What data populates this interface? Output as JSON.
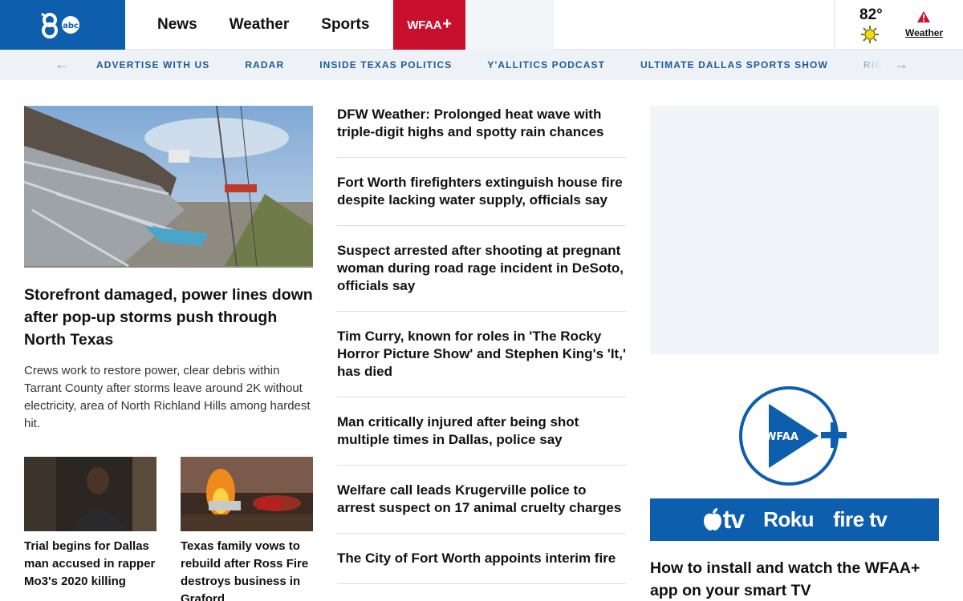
{
  "header": {
    "logo_text": "abc",
    "nav": [
      "News",
      "Weather",
      "Sports"
    ],
    "plus_tab": {
      "label": "WFAA",
      "plus": "+"
    },
    "weather": {
      "temp": "82°",
      "link": "Weather"
    }
  },
  "subnav": {
    "items": [
      "ADVERTISE WITH US",
      "RADAR",
      "INSIDE TEXAS POLITICS",
      "Y'ALLITICS PODCAST",
      "ULTIMATE DALLAS SPORTS SHOW",
      "RIGHT C"
    ]
  },
  "lead": {
    "title": "Storefront damaged, power lines down after pop-up storms push through North Texas",
    "description": "Crews work to restore power, clear debris within Tarrant County after storms leave around 2K without electricity, area of North Richland Hills among hardest hit."
  },
  "mini_cards": [
    {
      "title": "Trial begins for Dallas man accused in rapper Mo3's 2020 killing"
    },
    {
      "title": "Texas family vows to rebuild after Ross Fire destroys business in Graford"
    }
  ],
  "headlines": [
    "DFW Weather: Prolonged heat wave with triple-digit highs and spotty rain chances",
    "Fort Worth firefighters extinguish house fire despite lacking water supply, officials say",
    "Suspect arrested after shooting at pregnant woman during road rage incident in DeSoto, officials say",
    "Tim Curry, known for roles in 'The Rocky Horror Picture Show' and Stephen King's 'It,' has died",
    "Man critically injured after being shot multiple times in Dallas, police say",
    "Welfare call leads Krugerville police to arrest suspect on 17 animal cruelty charges",
    "The City of Fort Worth appoints interim fire"
  ],
  "promo": {
    "logo_text": "WFAA",
    "devices": [
      "tv",
      "Roku",
      "fire tv"
    ],
    "title": "How to install and watch the WFAA+ app on your smart TV"
  },
  "colors": {
    "brand_blue": "#0e5eae",
    "plus_red": "#c8102e",
    "subnav_text": "#1d5a9a"
  }
}
